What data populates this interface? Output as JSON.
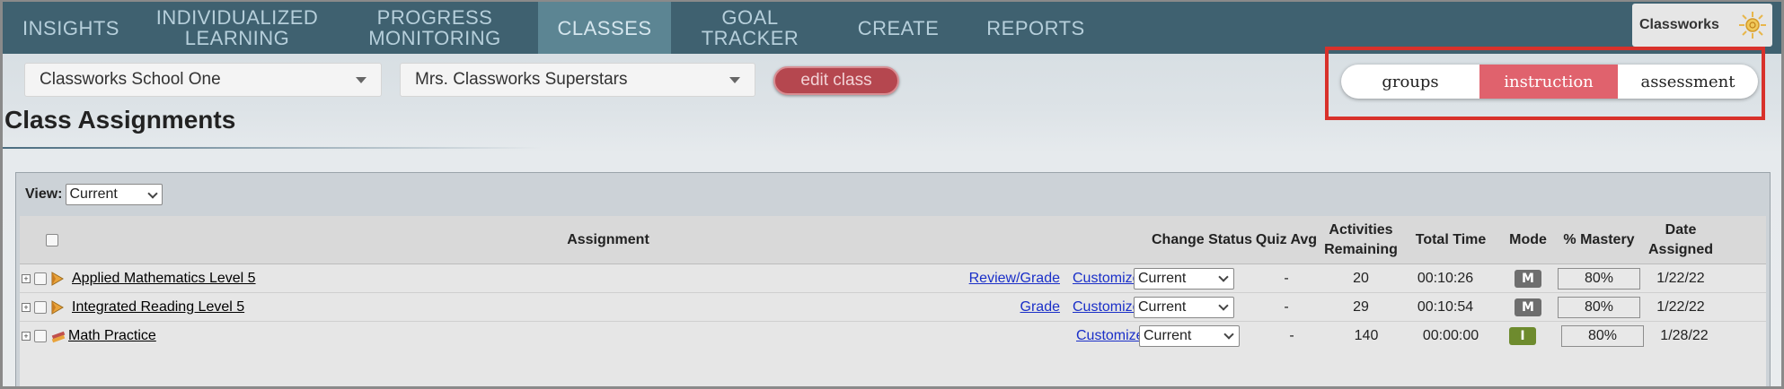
{
  "nav": {
    "items": [
      {
        "label": "INSIGHTS"
      },
      {
        "label": "INDIVIDUALIZED LEARNING"
      },
      {
        "label": "PROGRESS MONITORING"
      },
      {
        "label": "CLASSES"
      },
      {
        "label": "GOAL TRACKER"
      },
      {
        "label": "CREATE"
      },
      {
        "label": "REPORTS"
      }
    ],
    "active": "CLASSES",
    "brand": "Classworks"
  },
  "controls": {
    "school": "Classworks School One",
    "class": "Mrs. Classworks Superstars",
    "edit_class": "edit class"
  },
  "segmented": {
    "items": [
      {
        "label": "groups"
      },
      {
        "label": "instruction"
      },
      {
        "label": "assessment"
      }
    ],
    "active": "instruction"
  },
  "page_title": "Class Assignments",
  "view": {
    "label": "View:",
    "value": "Current"
  },
  "table": {
    "headers": {
      "assignment": "Assignment",
      "change_status": "Change Status",
      "quiz_avg": "Quiz Avg",
      "activities_remaining": "Activities Remaining",
      "total_time": "Total Time",
      "mode": "Mode",
      "mastery": "% Mastery",
      "date_assigned": "Date Assigned"
    },
    "rows": [
      {
        "name": "Applied Mathematics Level 5",
        "action": "Review/Grade",
        "customize": "Customize",
        "status": "Current",
        "quiz_avg": "-",
        "activities": "20",
        "time": "00:10:26",
        "mode": "M",
        "mastery": "80%",
        "date": "1/22/22"
      },
      {
        "name": "Integrated Reading Level 5",
        "action": "Grade",
        "customize": "Customize",
        "status": "Current",
        "quiz_avg": "-",
        "activities": "29",
        "time": "00:10:54",
        "mode": "M",
        "mastery": "80%",
        "date": "1/22/22"
      },
      {
        "name": "Math Practice",
        "action": "",
        "customize": "Customize",
        "status": "Current",
        "quiz_avg": "-",
        "activities": "140",
        "time": "00:00:00",
        "mode": "I",
        "mastery": "80%",
        "date": "1/28/22"
      }
    ]
  },
  "colors": {
    "nav_bg": "#3f6170",
    "nav_active": "#5c8593",
    "segment_active": "#e0626d",
    "edit_button": "#b5474f",
    "highlight": "#d8312b",
    "mode_m": "#6e6e6e",
    "mode_i": "#6e8b2e"
  }
}
